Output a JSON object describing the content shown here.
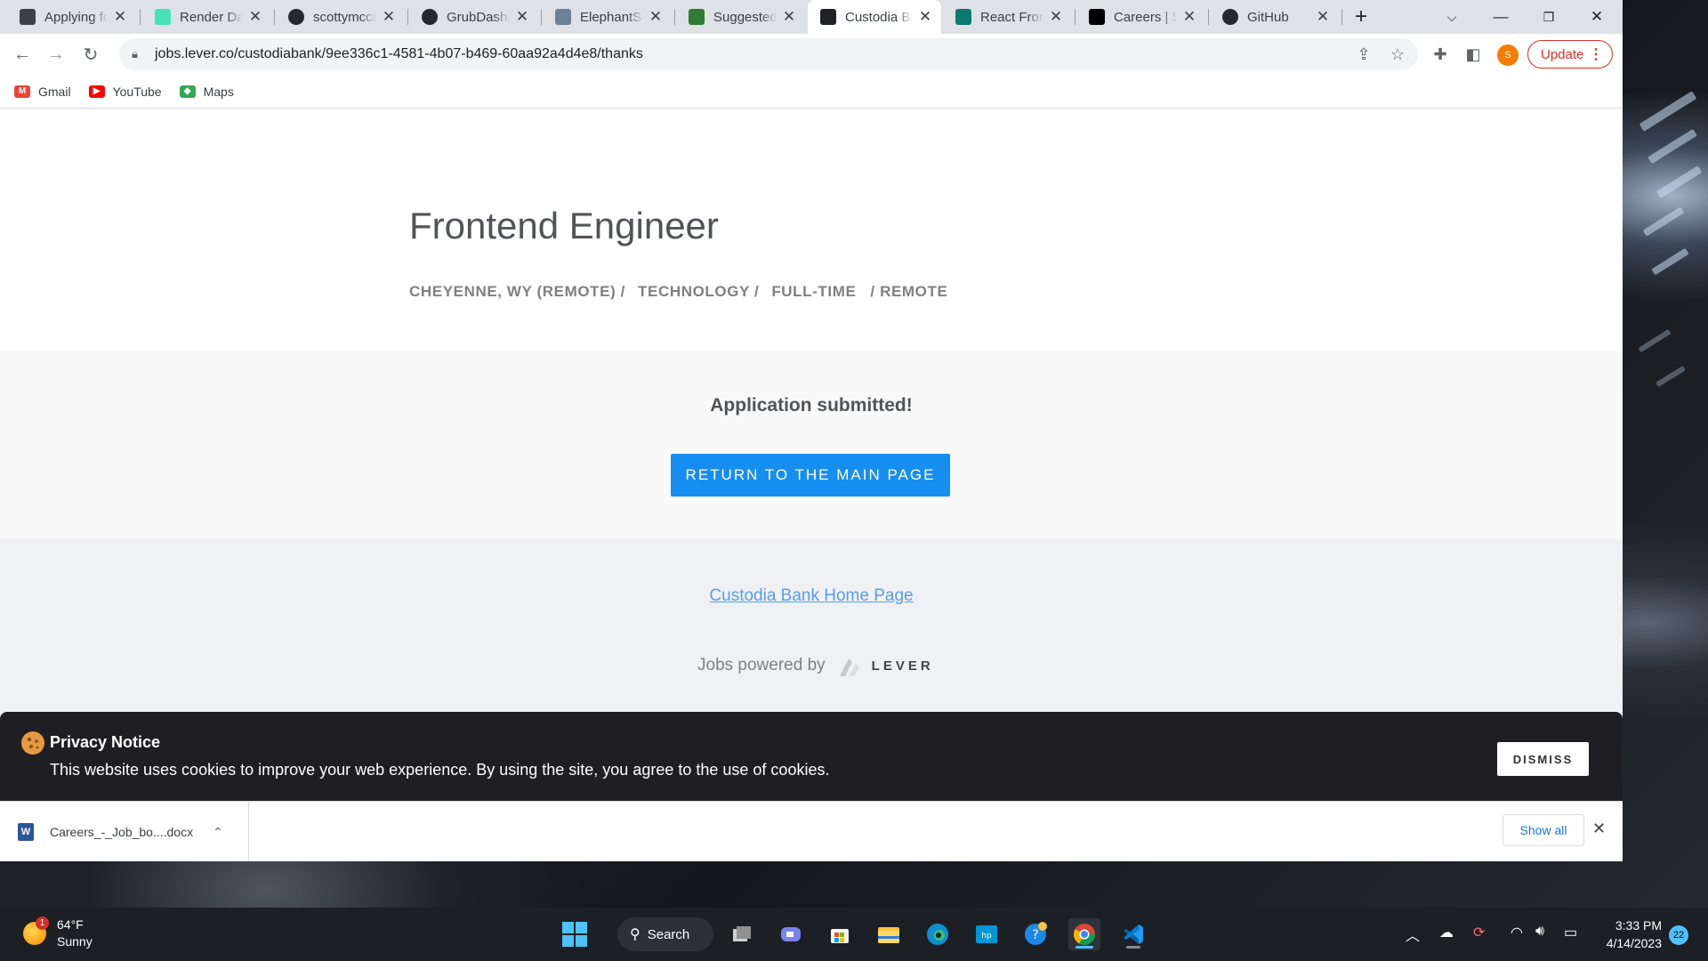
{
  "browser": {
    "tabs": [
      {
        "title": "Applying fo",
        "favicon": "#3c4043",
        "icon": "page-icon"
      },
      {
        "title": "Render Das",
        "favicon": "#46e3b7",
        "icon": "render-icon"
      },
      {
        "title": "scottymcca",
        "favicon": "#24292f",
        "icon": "github-icon"
      },
      {
        "title": "GrubDash/c",
        "favicon": "#24292f",
        "icon": "github-icon"
      },
      {
        "title": "ElephantSQ",
        "favicon": "#6b7f95",
        "icon": "elephant-icon"
      },
      {
        "title": "Suggested",
        "favicon": "#2e7d32",
        "icon": "suggested-icon"
      },
      {
        "title": "Custodia Ba",
        "favicon": "#202124",
        "icon": "lever-icon",
        "active": true
      },
      {
        "title": "React Front",
        "favicon": "#0b7a6e",
        "icon": "upwork-icon"
      },
      {
        "title": "Careers | S",
        "favicon": "#000000",
        "icon": "careers-icon"
      },
      {
        "title": "GitHub",
        "favicon": "#24292f",
        "icon": "github-icon"
      }
    ],
    "url": "jobs.lever.co/custodiabank/9ee336c1-4581-4b07-b469-60aa92a4d4e8/thanks",
    "profile_initial": "S",
    "update_label": "Update",
    "bookmarks": [
      {
        "label": "Gmail",
        "color": "#ea4335",
        "icon": "gmail-icon"
      },
      {
        "label": "YouTube",
        "color": "#ff0000",
        "icon": "youtube-icon"
      },
      {
        "label": "Maps",
        "color": "#34a853",
        "icon": "maps-icon"
      }
    ]
  },
  "page": {
    "title": "Frontend Engineer",
    "meta": [
      "CHEYENNE, WY (REMOTE) /",
      "TECHNOLOGY /",
      "FULL-TIME",
      "/ REMOTE"
    ],
    "confirmation": "Application submitted!",
    "return_button": "RETURN TO THE MAIN PAGE",
    "home_link": "Custodia Bank Home Page",
    "powered_by": "Jobs powered by",
    "lever_word": "LEVER",
    "accent_color": "#168ef0"
  },
  "privacy": {
    "title": "Privacy Notice",
    "text": "This website uses cookies to improve your web experience. By using the site, you agree to the use of cookies.",
    "dismiss": "DISMISS"
  },
  "downloads": {
    "file": "Careers_-_Job_bo....docx",
    "show_all": "Show all"
  },
  "taskbar": {
    "temperature": "64°F",
    "condition": "Sunny",
    "weather_badge": "1",
    "search_label": "Search",
    "time": "3:33 PM",
    "date": "4/14/2023",
    "notifications": "22"
  }
}
